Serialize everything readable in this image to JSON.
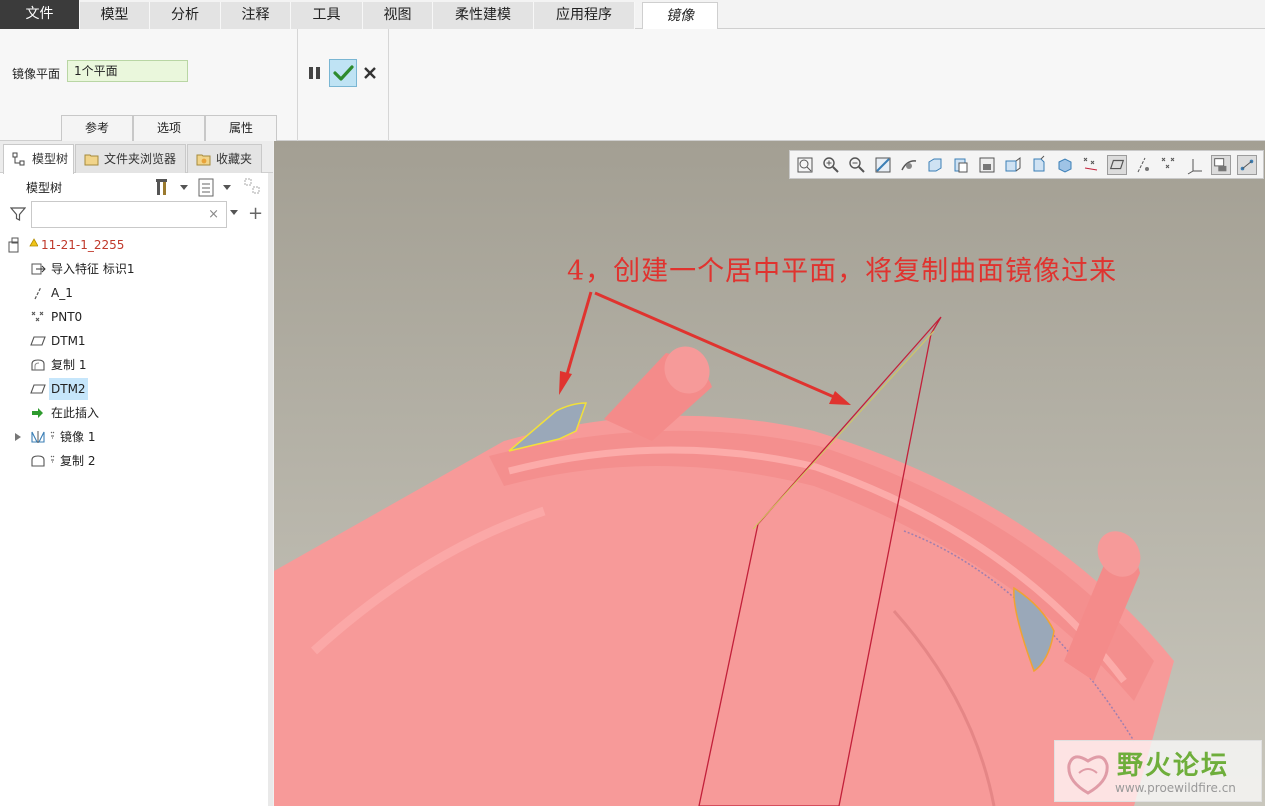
{
  "ribbon_tabs": [
    {
      "label": "文件"
    },
    {
      "label": "模型"
    },
    {
      "label": "分析"
    },
    {
      "label": "注释"
    },
    {
      "label": "工具"
    },
    {
      "label": "视图"
    },
    {
      "label": "柔性建模"
    },
    {
      "label": "应用程序"
    },
    {
      "label": "镜像"
    }
  ],
  "mirror": {
    "plane_label": "镜像平面",
    "plane_value": "1个平面"
  },
  "dashboard_subtabs": [
    "参考",
    "选项",
    "属性"
  ],
  "left_panel": {
    "tabs": [
      "模型树",
      "文件夹浏览器",
      "收藏夹"
    ],
    "tree_header": "模型树",
    "search_clear": "×",
    "add_symbol": "+",
    "tree_items": [
      {
        "label": "11-21-1_2255",
        "icon": "part-icon"
      },
      {
        "label": "导入特征 标识1",
        "icon": "import-feature-icon"
      },
      {
        "label": "A_1",
        "icon": "axis-icon"
      },
      {
        "label": "PNT0",
        "icon": "datum-point-icon"
      },
      {
        "label": "DTM1",
        "icon": "datum-plane-icon"
      },
      {
        "label": "复制 1",
        "icon": "copy-surface-icon"
      },
      {
        "label": "DTM2",
        "icon": "datum-plane-icon"
      },
      {
        "label": "在此插入",
        "icon": "insert-here-icon"
      },
      {
        "label": "镜像 1",
        "icon": "mirror-icon"
      },
      {
        "label": "复制 2",
        "icon": "copy-surface-icon"
      }
    ]
  },
  "viewport": {
    "annotation": "4，创建一个居中平面，将复制曲面镜像过来"
  },
  "watermark": {
    "title": "野火论坛",
    "url": "www.proewildfire.cn"
  },
  "colors": {
    "model": "#f59a9a",
    "annotation": "#e0332f",
    "accent_ok": "#bfe3f4",
    "selection": "#c6e6fb"
  }
}
